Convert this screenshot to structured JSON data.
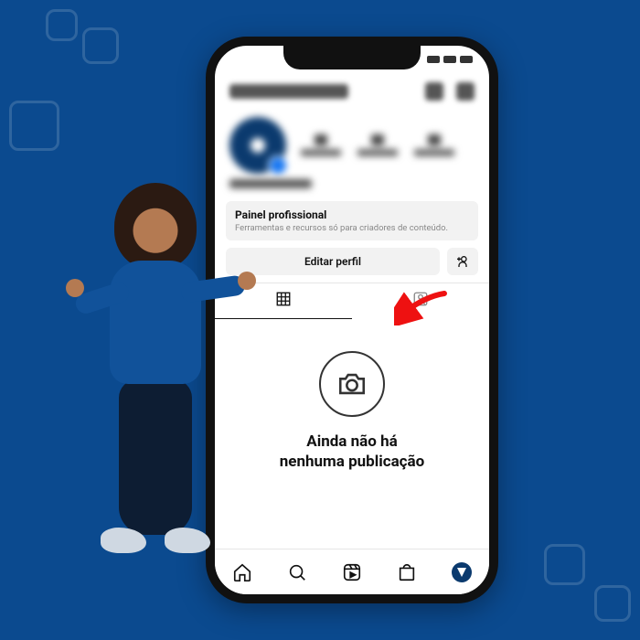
{
  "panel": {
    "title": "Painel profissional",
    "subtitle": "Ferramentas e recursos só para criadores de conteúdo."
  },
  "edit_profile_label": "Editar perfil",
  "empty_state": {
    "line1": "Ainda não há",
    "line2": "nenhuma publicação"
  },
  "icons": {
    "grid": "grid-icon",
    "tagged": "tagged-icon",
    "camera": "camera-icon",
    "home": "home-icon",
    "search": "search-icon",
    "reels": "reels-icon",
    "shop": "shop-icon",
    "add_friend": "add-friend-icon"
  }
}
